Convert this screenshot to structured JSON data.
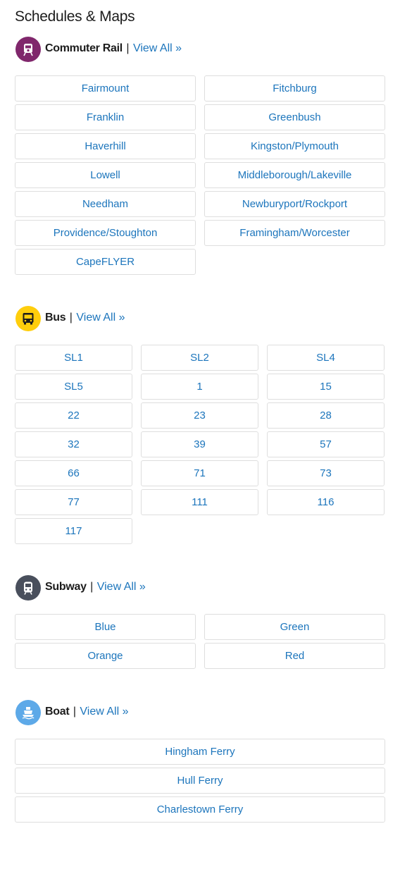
{
  "page_title": "Schedules & Maps",
  "separator": "|",
  "sections": [
    {
      "name": "Commuter Rail",
      "view_all": "View All »",
      "icon": "commuter-rail-icon",
      "icon_color": "#80276c",
      "routes": [
        "Fairmount",
        "Fitchburg",
        "Franklin",
        "Greenbush",
        "Haverhill",
        "Kingston/Plymouth",
        "Lowell",
        "Middleborough/Lakeville",
        "Needham",
        "Newburyport/Rockport",
        "Providence/Stoughton",
        "Framingham/Worcester",
        "CapeFLYER"
      ]
    },
    {
      "name": "Bus",
      "view_all": "View All »",
      "icon": "bus-icon",
      "icon_color": "#ffce0c",
      "routes": [
        "SL1",
        "SL2",
        "SL4",
        "SL5",
        "1",
        "15",
        "22",
        "23",
        "28",
        "32",
        "39",
        "57",
        "66",
        "71",
        "73",
        "77",
        "111",
        "116",
        "117"
      ]
    },
    {
      "name": "Subway",
      "view_all": "View All »",
      "icon": "subway-icon",
      "icon_color": "#494f5c",
      "routes": [
        "Blue",
        "Green",
        "Orange",
        "Red"
      ]
    },
    {
      "name": "Boat",
      "view_all": "View All »",
      "icon": "boat-icon",
      "icon_color": "#5da9e8",
      "routes": [
        "Hingham Ferry",
        "Hull Ferry",
        "Charlestown Ferry"
      ]
    }
  ],
  "colors": {
    "link": "#1c75bc",
    "border": "#dedede",
    "text": "#1c1c1c"
  }
}
